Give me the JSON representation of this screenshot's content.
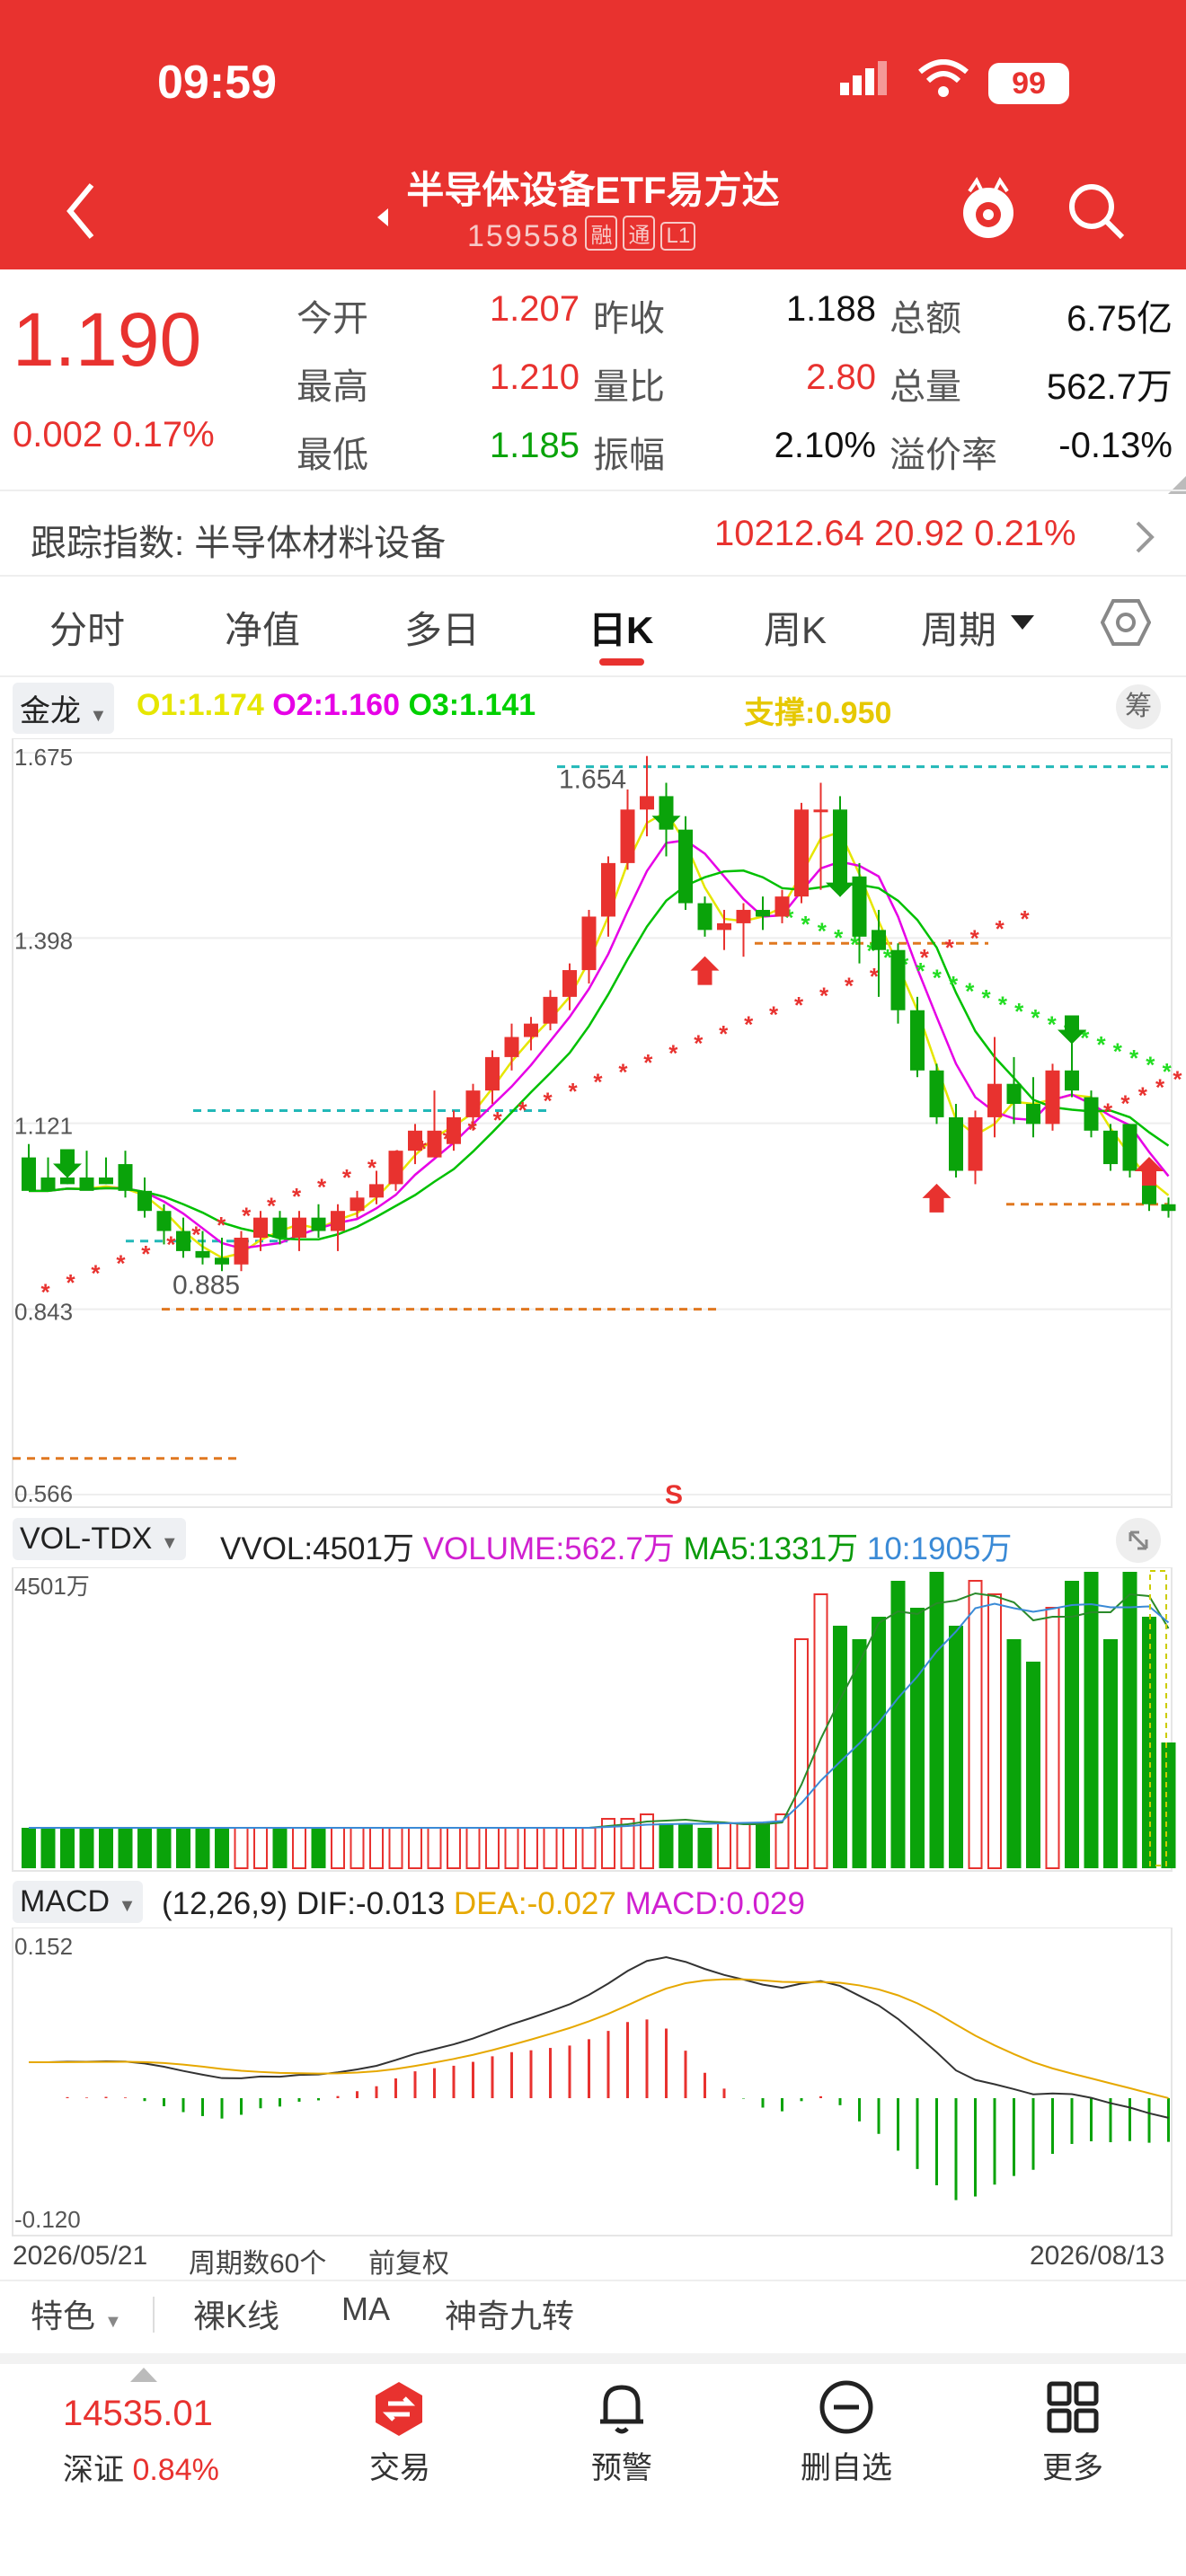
{
  "status_bar": {
    "time": "09:59",
    "battery": "99"
  },
  "header": {
    "title": "半导体设备ETF易方达",
    "code": "159558",
    "tags": [
      "融",
      "通",
      "L1"
    ]
  },
  "quote": {
    "price": "1.190",
    "change": "0.002",
    "change_pct": "0.17%",
    "fields": [
      {
        "label": "今开",
        "value": "1.207",
        "color": "red"
      },
      {
        "label": "昨收",
        "value": "1.188",
        "color": "dark"
      },
      {
        "label": "总额",
        "value": "6.75亿",
        "color": "dark"
      },
      {
        "label": "最高",
        "value": "1.210",
        "color": "red"
      },
      {
        "label": "量比",
        "value": "2.80",
        "color": "red"
      },
      {
        "label": "总量",
        "value": "562.7万",
        "color": "dark"
      },
      {
        "label": "最低",
        "value": "1.185",
        "color": "green"
      },
      {
        "label": "振幅",
        "value": "2.10%",
        "color": "dark"
      },
      {
        "label": "溢价率",
        "value": "-0.13%",
        "color": "dark"
      }
    ]
  },
  "tracking": {
    "label": "跟踪指数: 半导体材料设备",
    "value": "10212.64",
    "change": "20.92",
    "pct": "0.21%"
  },
  "tabs": [
    "分时",
    "净值",
    "多日",
    "日K",
    "周K",
    "周期"
  ],
  "active_tab": "日K",
  "kline": {
    "indicator": "金龙",
    "legend": {
      "o1": "O1:1.174",
      "o2": "O2:1.160",
      "o3": "O3:1.141",
      "support": "支撑:0.950"
    },
    "chip_button": "筹",
    "y_labels": [
      "1.675",
      "1.398",
      "1.121",
      "0.843",
      "0.566"
    ],
    "high_mark": "1.654",
    "low_mark": "0.885",
    "signal": "S"
  },
  "volume": {
    "indicator": "VOL-TDX",
    "legend": {
      "vvol": "VVOL:4501万",
      "volume": "VOLUME:562.7万",
      "ma5": "MA5:1331万",
      "ma10": "10:1905万"
    },
    "y_label": "4501万"
  },
  "macd": {
    "indicator": "MACD",
    "legend": {
      "params": "(12,26,9)",
      "dif": "DIF:-0.013",
      "dea": "DEA:-0.027",
      "macd": "MACD:0.029"
    },
    "y_top": "0.152",
    "y_bottom": "-0.120"
  },
  "footer_info": {
    "start_date": "2026/05/21",
    "periods": "周期数60个",
    "adjust": "前复权",
    "end_date": "2026/08/13"
  },
  "tools": [
    "特色",
    "裸K线",
    "MA",
    "神奇九转"
  ],
  "nav": {
    "index_value": "14535.01",
    "index_name": "深证",
    "index_pct": "0.84%",
    "items": [
      "交易",
      "预警",
      "删自选",
      "更多"
    ]
  },
  "colors": {
    "up": "#e8322f",
    "down": "#0aa30a",
    "header": "#e8322f"
  },
  "chart_data": {
    "type": "candlestick",
    "count": 60,
    "ohlc": [
      [
        1.07,
        1.09,
        1.04,
        1.02
      ],
      [
        1.04,
        1.07,
        1.03,
        1.02
      ],
      [
        1.04,
        1.08,
        1.03,
        1.03
      ],
      [
        1.04,
        1.08,
        1.03,
        1.02
      ],
      [
        1.04,
        1.07,
        1.03,
        1.03
      ],
      [
        1.06,
        1.08,
        1.01,
        1.02
      ],
      [
        1.02,
        1.04,
        0.98,
        0.99
      ],
      [
        0.99,
        1.0,
        0.94,
        0.96
      ],
      [
        0.96,
        0.98,
        0.92,
        0.93
      ],
      [
        0.93,
        0.96,
        0.91,
        0.92
      ],
      [
        0.92,
        0.95,
        0.9,
        0.91
      ],
      [
        0.91,
        0.96,
        0.9,
        0.95
      ],
      [
        0.95,
        0.99,
        0.93,
        0.98
      ],
      [
        0.98,
        0.99,
        0.94,
        0.95
      ],
      [
        0.95,
        0.99,
        0.93,
        0.98
      ],
      [
        0.98,
        1.0,
        0.95,
        0.96
      ],
      [
        0.96,
        1.0,
        0.93,
        0.99
      ],
      [
        0.99,
        1.02,
        0.98,
        1.01
      ],
      [
        1.01,
        1.05,
        1.0,
        1.03
      ],
      [
        1.03,
        1.08,
        1.02,
        1.08
      ],
      [
        1.08,
        1.12,
        1.06,
        1.11
      ],
      [
        1.07,
        1.17,
        1.07,
        1.11
      ],
      [
        1.09,
        1.14,
        1.08,
        1.13
      ],
      [
        1.13,
        1.18,
        1.11,
        1.17
      ],
      [
        1.17,
        1.23,
        1.15,
        1.22
      ],
      [
        1.22,
        1.27,
        1.2,
        1.25
      ],
      [
        1.25,
        1.28,
        1.23,
        1.27
      ],
      [
        1.27,
        1.32,
        1.26,
        1.31
      ],
      [
        1.31,
        1.36,
        1.29,
        1.35
      ],
      [
        1.35,
        1.44,
        1.33,
        1.43
      ],
      [
        1.43,
        1.52,
        1.4,
        1.51
      ],
      [
        1.51,
        1.62,
        1.5,
        1.59
      ],
      [
        1.59,
        1.67,
        1.55,
        1.61
      ],
      [
        1.61,
        1.63,
        1.52,
        1.56
      ],
      [
        1.56,
        1.58,
        1.44,
        1.45
      ],
      [
        1.45,
        1.46,
        1.4,
        1.41
      ],
      [
        1.41,
        1.44,
        1.38,
        1.42
      ],
      [
        1.42,
        1.45,
        1.37,
        1.44
      ],
      [
        1.44,
        1.46,
        1.41,
        1.43
      ],
      [
        1.43,
        1.47,
        1.42,
        1.46
      ],
      [
        1.46,
        1.6,
        1.45,
        1.59
      ],
      [
        1.59,
        1.63,
        1.47,
        1.59
      ],
      [
        1.59,
        1.61,
        1.46,
        1.49
      ],
      [
        1.49,
        1.51,
        1.36,
        1.4
      ],
      [
        1.41,
        1.44,
        1.31,
        1.38
      ],
      [
        1.38,
        1.39,
        1.27,
        1.29
      ],
      [
        1.29,
        1.31,
        1.19,
        1.2
      ],
      [
        1.2,
        1.21,
        1.12,
        1.13
      ],
      [
        1.13,
        1.15,
        1.04,
        1.05
      ],
      [
        1.05,
        1.14,
        1.03,
        1.13
      ],
      [
        1.13,
        1.25,
        1.1,
        1.18
      ],
      [
        1.18,
        1.22,
        1.12,
        1.15
      ],
      [
        1.15,
        1.19,
        1.1,
        1.12
      ],
      [
        1.12,
        1.21,
        1.11,
        1.2
      ],
      [
        1.2,
        1.25,
        1.16,
        1.17
      ],
      [
        1.16,
        1.17,
        1.1,
        1.11
      ],
      [
        1.11,
        1.12,
        1.05,
        1.06
      ],
      [
        1.12,
        1.12,
        1.04,
        1.05
      ],
      [
        1.05,
        1.06,
        0.99,
        1.0
      ],
      [
        1.0,
        1.01,
        0.98,
        0.99
      ]
    ]
  }
}
